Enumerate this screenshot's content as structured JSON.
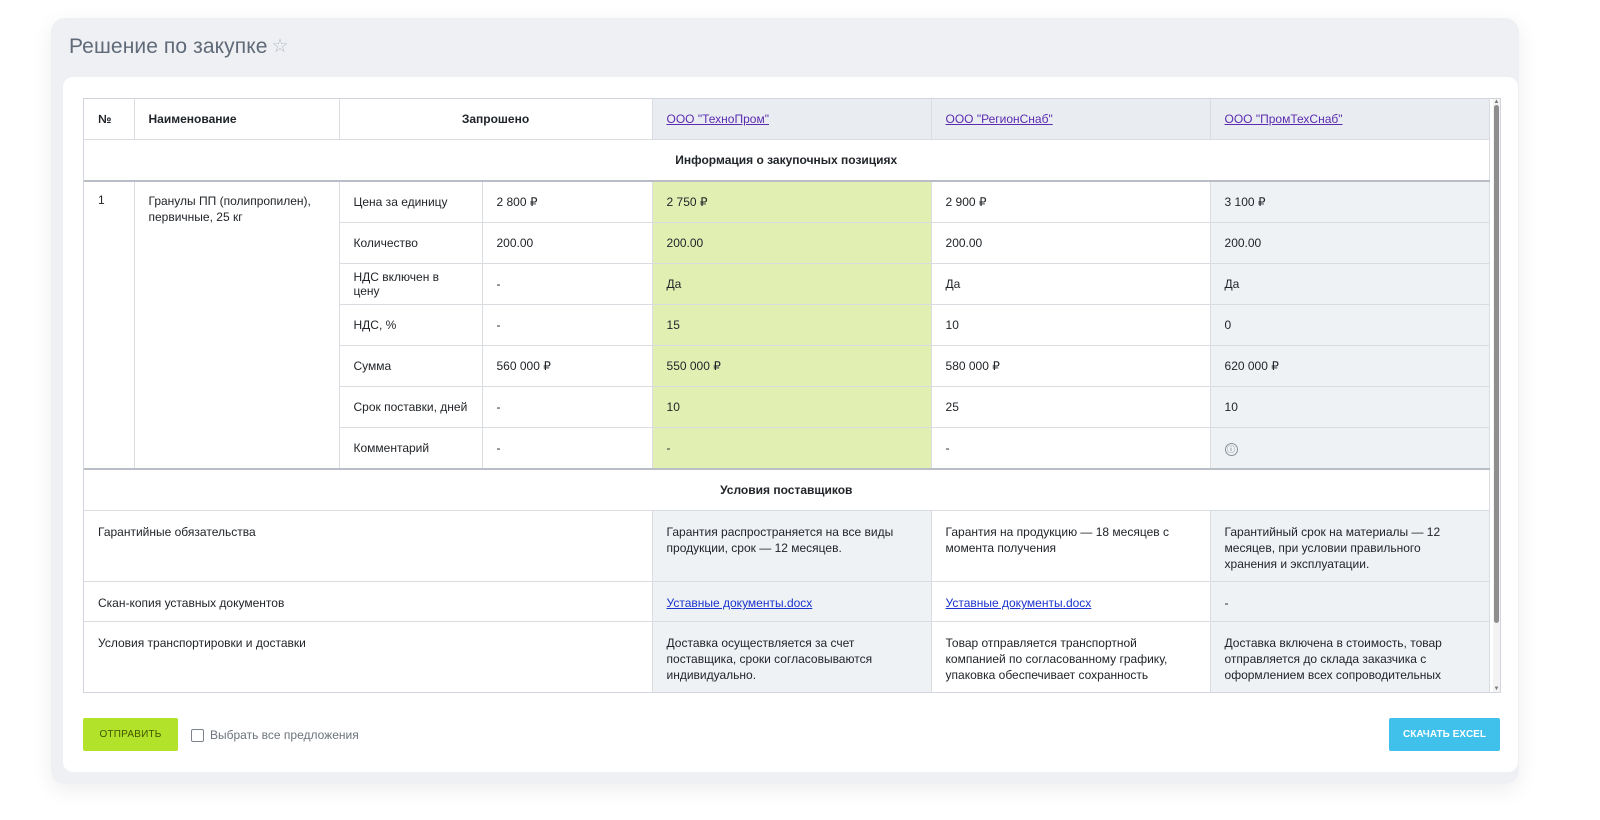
{
  "header": {
    "title": "Решение по закупке",
    "star_icon": "☆"
  },
  "table": {
    "columns": {
      "num": "№",
      "name": "Наименование",
      "requested": "Запрошено",
      "suppliers": [
        "ООО \"ТехноПром\"",
        "ООО \"РегионСнаб\"",
        "ООО \"ПромТехСнаб\""
      ]
    },
    "section_positions": "Информация о закупочных позициях",
    "item": {
      "num": "1",
      "name": "Гранулы ПП (полипропилен), первичные, 25 кг",
      "rows": [
        {
          "label": "Цена за единицу",
          "requested": "2 800 ₽",
          "s1": "2 750 ₽",
          "s2": "2 900 ₽",
          "s3": "3 100 ₽"
        },
        {
          "label": "Количество",
          "requested": "200.00",
          "s1": "200.00",
          "s2": "200.00",
          "s3": "200.00"
        },
        {
          "label": "НДС включен в цену",
          "requested": "-",
          "s1": "Да",
          "s2": "Да",
          "s3": "Да"
        },
        {
          "label": "НДС, %",
          "requested": "-",
          "s1": "15",
          "s2": "10",
          "s3": "0"
        },
        {
          "label": "Сумма",
          "requested": "560 000 ₽",
          "s1": "550 000 ₽",
          "s2": "580 000 ₽",
          "s3": "620 000 ₽"
        },
        {
          "label": "Срок поставки, дней",
          "requested": "-",
          "s1": "10",
          "s2": "25",
          "s3": "10"
        },
        {
          "label": "Комментарий",
          "requested": "-",
          "s1": "-",
          "s2": "-",
          "s3": "ⓘ"
        }
      ]
    },
    "section_conditions": "Условия поставщиков",
    "conditions": [
      {
        "label": "Гарантийные обязательства",
        "s1": "Гарантия распространяется на все виды продукции, срок — 12 месяцев.",
        "s2": "Гарантия на продукцию — 18 месяцев с момента получения",
        "s3": "Гарантийный срок на материалы — 12 месяцев, при условии правильного хранения и эксплуатации."
      },
      {
        "label": "Скан-копия уставных документов",
        "s1": "Уставные документы.docx",
        "s2": "Уставные документы.docx",
        "s3": "-"
      },
      {
        "label": "Условия транспортировки и доставки",
        "s1": "Доставка осуществляется за счет поставщика, сроки согласовываются индивидуально.",
        "s2": "Товар отправляется транспортной компанией по согласованному графику, упаковка обеспечивает сохранность",
        "s3": "Доставка включена в стоимость, товар отправляется до склада заказчика с оформлением всех сопроводительных"
      }
    ]
  },
  "footer": {
    "send_label": "ОТПРАВИТЬ",
    "select_all_label": "Выбрать все предложения",
    "excel_label": "СКАЧАТЬ EXCEL"
  },
  "colors": {
    "accent_green": "#b3e22b",
    "winner_bg": "#e1efb3",
    "excel_blue": "#40c1ec",
    "supplier_link": "#5b2bb0"
  }
}
